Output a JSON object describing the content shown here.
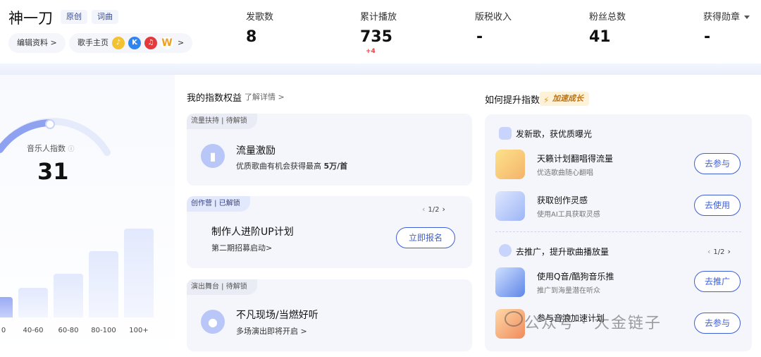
{
  "header": {
    "username": "神一刀",
    "tags": [
      "原创",
      "词曲"
    ],
    "edit_profile": "编辑资料 >",
    "singer_home": "歌手主页",
    "singer_home_arrow": ">",
    "stats": [
      {
        "label": "发歌数",
        "value": "8",
        "delta": ""
      },
      {
        "label": "累计播放",
        "value": "735",
        "delta": "+4"
      },
      {
        "label": "版税收入",
        "value": "-",
        "delta": ""
      },
      {
        "label": "粉丝总数",
        "value": "41",
        "delta": ""
      },
      {
        "label": "获得勋章",
        "value": "-",
        "delta": ""
      }
    ]
  },
  "index": {
    "label": "音乐人指数",
    "value": "31",
    "help_icon": "question-icon",
    "bars": [
      {
        "label": "0",
        "level": 0.18,
        "active": true
      },
      {
        "label": "40-60",
        "level": 0.26,
        "active": false
      },
      {
        "label": "60-80",
        "level": 0.39,
        "active": false
      },
      {
        "label": "80-100",
        "level": 0.59,
        "active": false
      },
      {
        "label": "100+",
        "level": 0.79,
        "active": false
      }
    ]
  },
  "benefits": {
    "title": "我的指数权益",
    "link": "了解详情 >",
    "cards": [
      {
        "tag": "流量扶持 | 待解锁",
        "title": "流量激励",
        "sub": "优质歌曲有机会获得最高",
        "sub_bold": "5万/首"
      },
      {
        "tag": "创作营 | 已解锁",
        "pager": "1/2",
        "title": "制作人进阶UP计划",
        "sub": "第二期招募启动>",
        "button": "立即报名"
      },
      {
        "tag": "演出舞台 | 待解锁",
        "title": "不凡现场/当燃好听",
        "sub": "多场演出即将开启 >"
      }
    ]
  },
  "improve": {
    "title": "如何提升指数",
    "badge": "加速成长",
    "group1": {
      "title": "发新歌，获优质曝光",
      "items": [
        {
          "title": "天籁计划翻唱得流量",
          "sub": "优选歌曲随心翻唱",
          "button": "去参与"
        },
        {
          "title": "获取创作灵感",
          "sub": "使用AI工具获取灵感",
          "button": "去使用"
        }
      ]
    },
    "group2": {
      "title": "去推广，提升歌曲播放量",
      "pager": "1/2",
      "items": [
        {
          "title": "使用Q音/酷狗音乐推",
          "sub": "推广到海量潜在听众",
          "button": "去推广"
        },
        {
          "title": "参与音浪加速计划",
          "sub": "",
          "button": "去参与"
        }
      ]
    }
  },
  "watermark": "公众号 · 大金链子",
  "colors": {
    "accent": "#3f5fd6",
    "delta": "#e0454a",
    "badge_text": "#b8741a"
  }
}
